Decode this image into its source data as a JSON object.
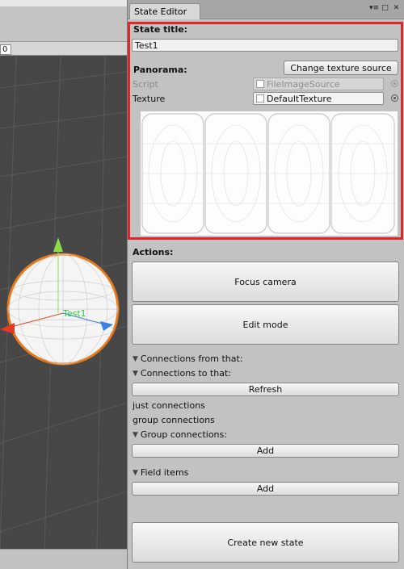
{
  "scene": {
    "field_value": "0",
    "object_label": "Test1"
  },
  "window": {
    "tab_title": "State Editor",
    "controls": {
      "menu": "▾≡",
      "maximize": "□",
      "close": "✕"
    }
  },
  "state_section": {
    "title_label": "State title:",
    "title_value": "Test1",
    "panorama_label": "Panorama:",
    "change_texture_button": "Change texture source",
    "script_label": "Script",
    "script_value": "FileImageSource",
    "texture_label": "Texture",
    "texture_value": "DefaultTexture"
  },
  "actions": {
    "label": "Actions:",
    "focus_camera": "Focus camera",
    "edit_mode": "Edit mode"
  },
  "connections": {
    "from_label": "Connections from that:",
    "to_label": "Connections to that:",
    "refresh_button": "Refresh",
    "just_connections": "just connections",
    "group_connections": "group connections",
    "group_foldout": "Group connections:",
    "group_add_button": "Add"
  },
  "field_items": {
    "label": "Field items",
    "add_button": "Add"
  },
  "create_button": "Create new state",
  "colors": {
    "highlight": "#e0262a",
    "scene_bg": "#474747",
    "panel_bg": "#c2c2c2"
  }
}
